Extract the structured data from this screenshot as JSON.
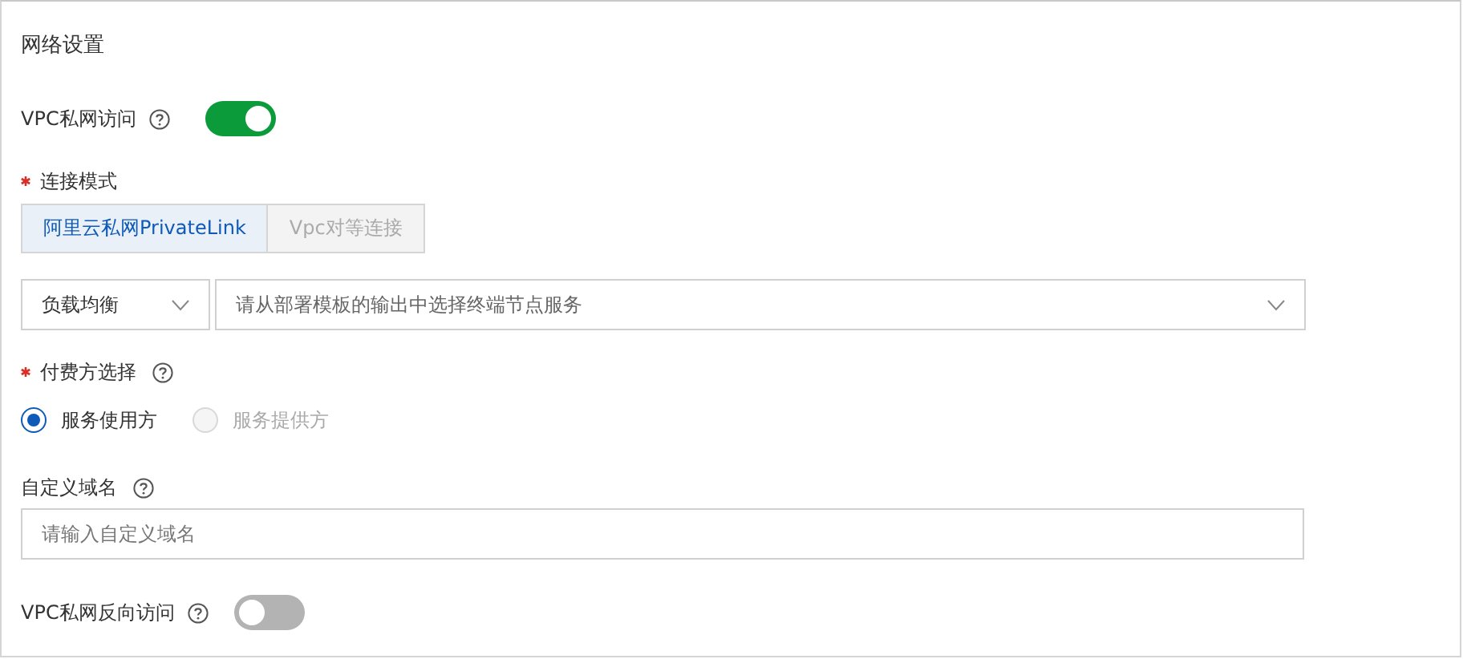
{
  "section_title": "网络设置",
  "vpc_access": {
    "label": "VPC私网访问",
    "help": true,
    "on": true
  },
  "connection_mode": {
    "label": "连接模式",
    "required": true,
    "options": [
      {
        "label": "阿里云私网PrivateLink",
        "selected": true
      },
      {
        "label": "Vpc对等连接",
        "selected": false
      }
    ]
  },
  "endpoint_selects": [
    {
      "kind": "value",
      "text": "负载均衡"
    },
    {
      "kind": "placeholder",
      "text": "请从部署模板的输出中选择终端节点服务"
    }
  ],
  "payer": {
    "label": "付费方选择",
    "required": true,
    "help": true,
    "options": [
      {
        "label": "服务使用方",
        "selected": true,
        "disabled": false
      },
      {
        "label": "服务提供方",
        "selected": false,
        "disabled": true
      }
    ]
  },
  "custom_domain": {
    "label": "自定义域名",
    "help": true,
    "placeholder": "请输入自定义域名"
  },
  "vpc_reverse": {
    "label": "VPC私网反向访问",
    "help": true,
    "on": false
  }
}
